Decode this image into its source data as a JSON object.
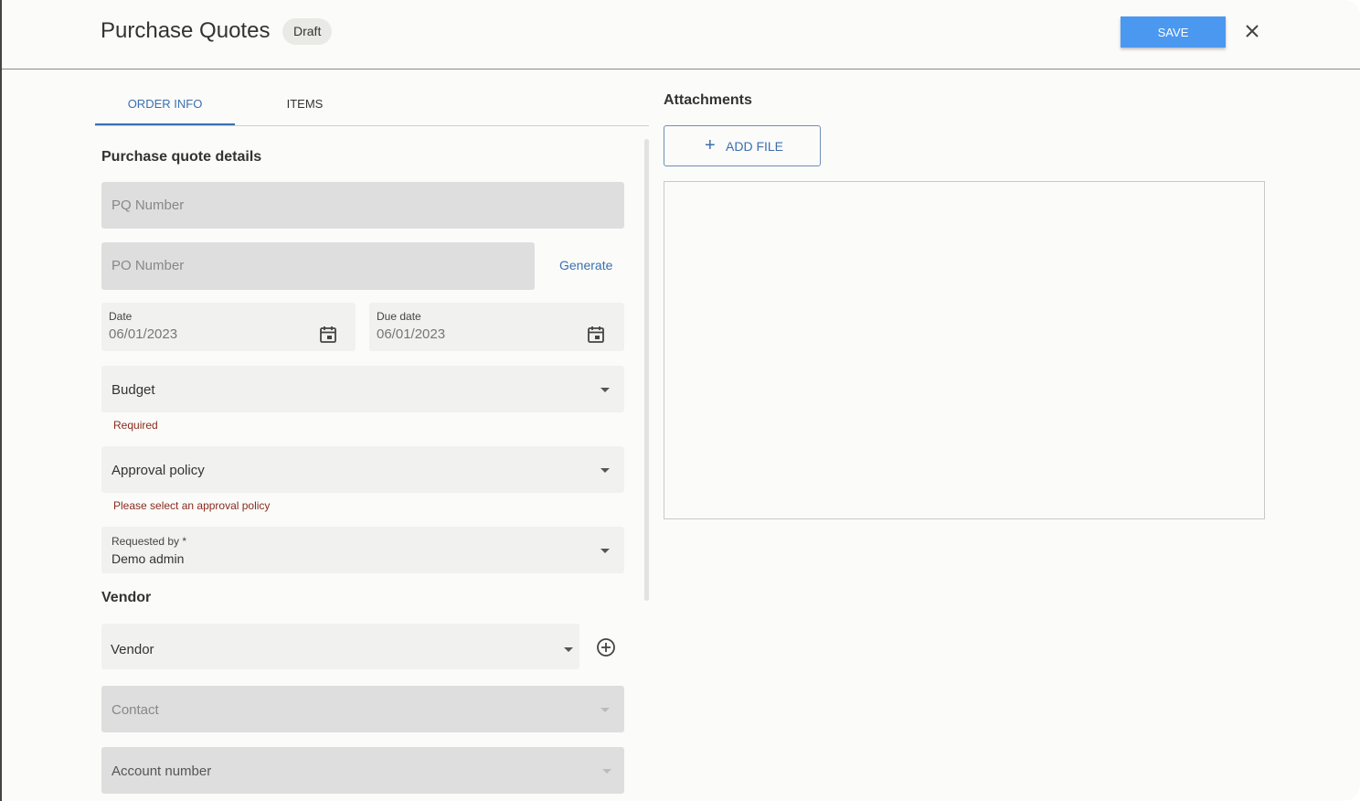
{
  "header": {
    "title": "Purchase Quotes",
    "status_badge": "Draft",
    "save_label": "SAVE"
  },
  "tabs": [
    {
      "label": "ORDER INFO",
      "active": true
    },
    {
      "label": "ITEMS",
      "active": false
    }
  ],
  "details": {
    "section_title": "Purchase quote details",
    "pq_number_placeholder": "PQ Number",
    "po_number_placeholder": "PO Number",
    "generate_label": "Generate",
    "date_label": "Date",
    "date_value": "06/01/2023",
    "due_date_label": "Due date",
    "due_date_value": "06/01/2023",
    "budget_placeholder": "Budget",
    "budget_helper": "Required",
    "approval_placeholder": "Approval policy",
    "approval_helper": "Please select an approval policy",
    "requested_by_label": "Requested by *",
    "requested_by_value": "Demo admin"
  },
  "vendor": {
    "section_title": "Vendor",
    "vendor_placeholder": "Vendor",
    "contact_placeholder": "Contact",
    "account_placeholder": "Account number"
  },
  "attachments": {
    "title": "Attachments",
    "add_file_label": "ADD FILE"
  },
  "colors": {
    "accent": "#3b6fae",
    "save_button": "#4a98ef",
    "error_text": "#8a2b1c"
  },
  "icons": {
    "close": "close-icon",
    "calendar": "calendar-icon",
    "dropdown": "chevron-down-icon",
    "add_vendor": "add-circle-icon",
    "add_file": "plus-icon"
  }
}
